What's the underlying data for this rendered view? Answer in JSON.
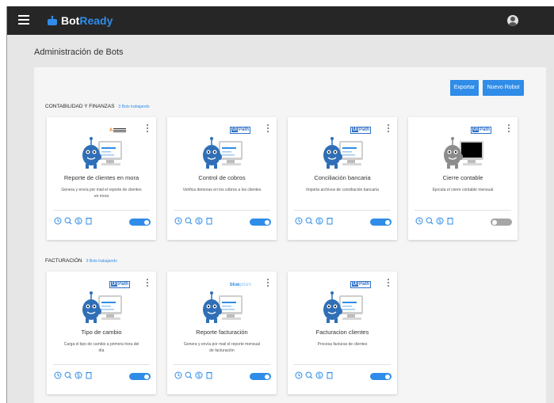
{
  "app": {
    "brand_bot": "Bot",
    "brand_ready": "Ready"
  },
  "page_title": "Administración de Bots",
  "toolbar": {
    "export_label": "Exportar",
    "new_robot_label": "Nuevo Robot"
  },
  "sections": [
    {
      "title": "CONTABILIDAD Y FINANZAS",
      "subtitle": "3 Bots trabajando",
      "cards": [
        {
          "name": "Reporte de clientes en mora",
          "desc_line1": "Genera y envía por mail el reporte de clientes",
          "desc_line2": "en mora",
          "platform": "automation-anywhere",
          "badge_text": "A",
          "active": true
        },
        {
          "name": "Control de cobros",
          "desc_line1": "Verifica demoras en los cobros a los clientes",
          "desc_line2": "",
          "platform": "uipath",
          "badge_ui": "Ui",
          "badge_path": "Path",
          "active": true
        },
        {
          "name": "Conciliación bancaria",
          "desc_line1": "Importa archivos de conciliación bancaria",
          "desc_line2": "",
          "platform": "uipath",
          "badge_ui": "Ui",
          "badge_path": "Path",
          "active": true
        },
        {
          "name": "Cierre contable",
          "desc_line1": "Ejecuta el cierre contable mensual",
          "desc_line2": "",
          "platform": "uipath",
          "badge_ui": "Ui",
          "badge_path": "Path",
          "active": false
        }
      ]
    },
    {
      "title": "FACTURACIÓN",
      "subtitle": "3 Bots trabajando",
      "cards": [
        {
          "name": "Tipo de cambio",
          "desc_line1": "Carga el tipo de cambio a primera hora del",
          "desc_line2": "día",
          "platform": "uipath",
          "badge_ui": "Ui",
          "badge_path": "Path",
          "active": true
        },
        {
          "name": "Reporte facturación",
          "desc_line1": "Genera y envía por mail el reporte mensual",
          "desc_line2": "de facturación",
          "platform": "blueprism",
          "badge_blue": "blue",
          "badge_prism": "prism",
          "active": true
        },
        {
          "name": "Facturacion clientes",
          "desc_line1": "Procesa facturas de clientes",
          "desc_line2": "",
          "platform": "uipath",
          "badge_ui": "Ui",
          "badge_path": "Path",
          "active": true
        }
      ]
    }
  ],
  "icons": [
    "menu-icon",
    "bot-logo-icon",
    "user-avatar-icon",
    "kebab-menu-icon",
    "clock-icon",
    "search-icon",
    "dollar-icon",
    "document-icon"
  ],
  "colors": {
    "topbar": "#262626",
    "accent": "#2f8ce8",
    "background": "#e6e6e6",
    "panel": "#f5f5f5",
    "toggle_off": "#a6a6a6",
    "robot_active": "#2f6fb7",
    "robot_inactive": "#8c8c8c"
  }
}
